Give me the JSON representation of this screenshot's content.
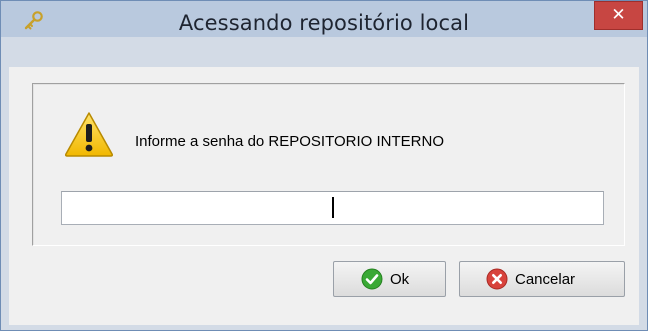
{
  "window": {
    "title": "Acessando repositório local",
    "close_glyph": "✕",
    "title_icon": "key-icon"
  },
  "dialog": {
    "icon": "warning-icon",
    "message": "Informe a senha do REPOSITORIO INTERNO",
    "password_value": ""
  },
  "buttons": {
    "ok_label": "Ok",
    "ok_icon": "check-circle-icon",
    "cancel_label": "Cancelar",
    "cancel_icon": "x-circle-icon"
  },
  "colors": {
    "titlebar": "#b9c9de",
    "close_button": "#c74642",
    "dialog_background": "#f0f0f0",
    "warning_yellow": "#f5c400",
    "ok_green": "#3aa935",
    "cancel_red": "#d8433c"
  }
}
